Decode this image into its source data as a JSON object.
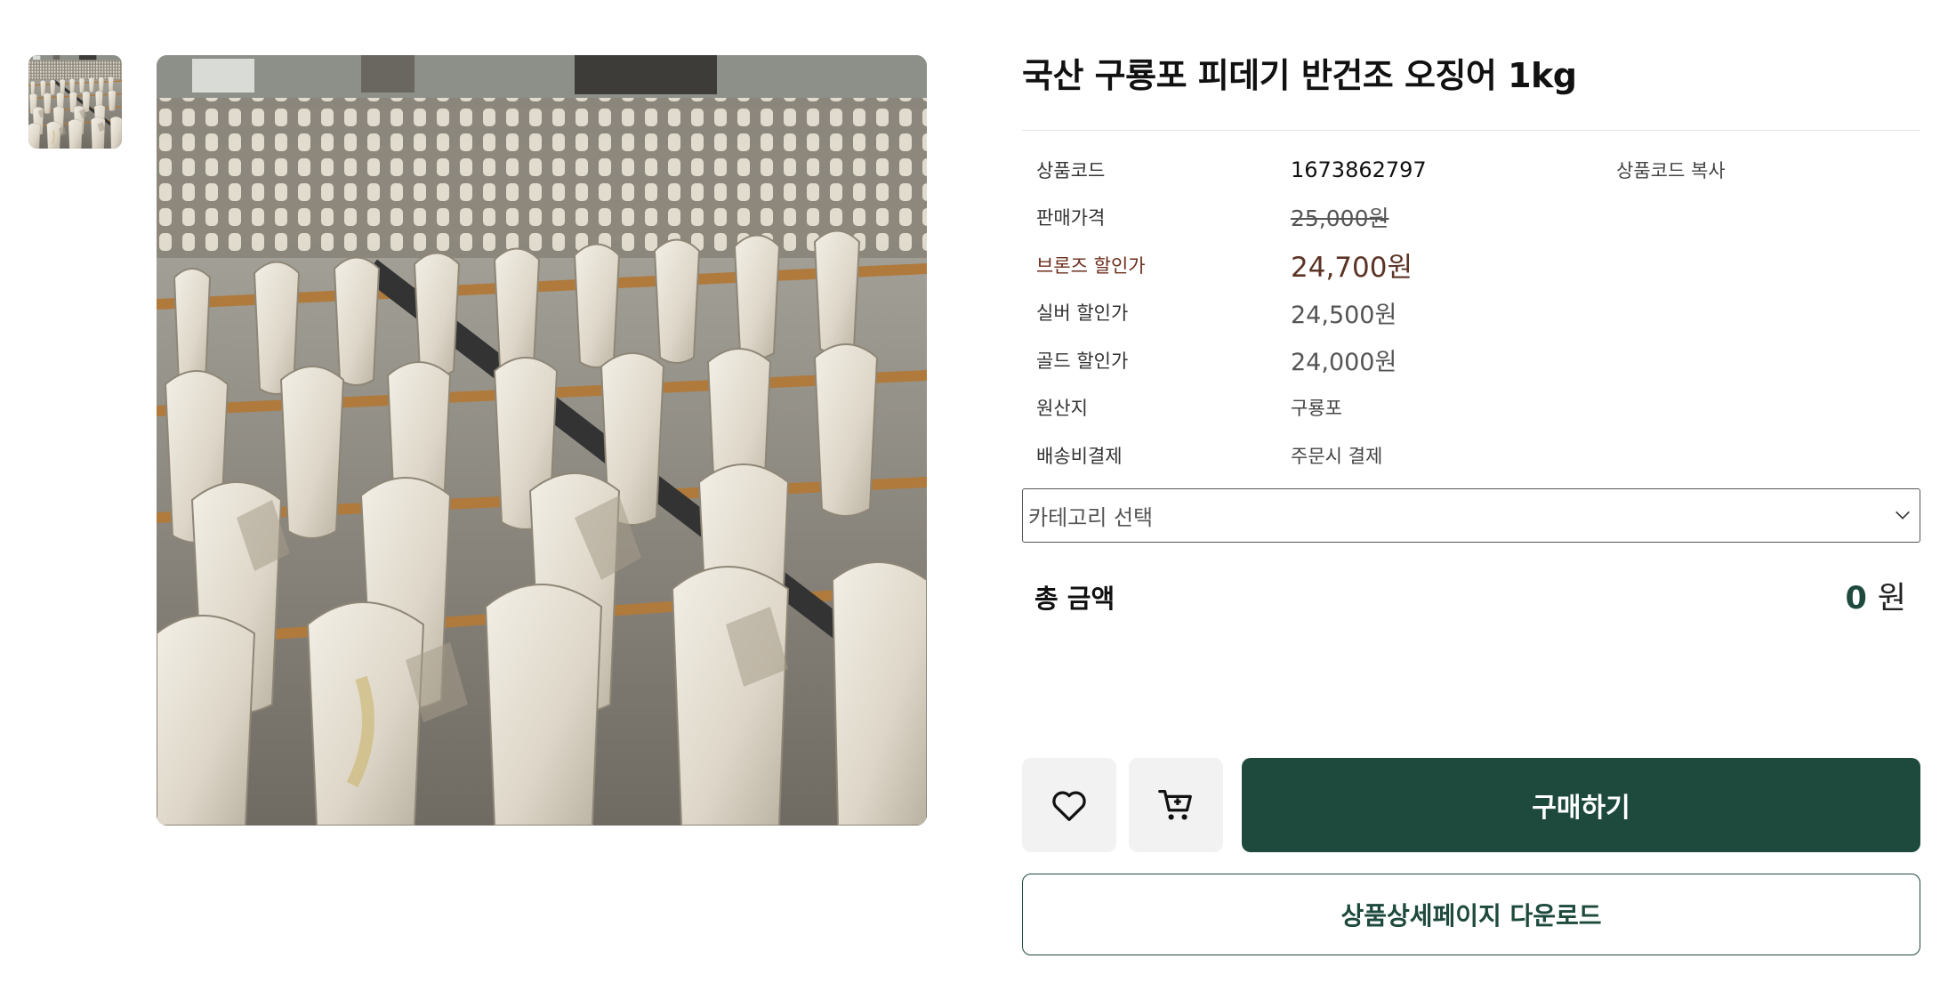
{
  "product": {
    "title": "국산 구룡포 피데기 반건조 오징어 1kg",
    "code_label": "상품코드",
    "code_value": "1673862797",
    "copy_code_label": "상품코드 복사",
    "price_label": "판매가격",
    "price_value": "25,000원",
    "bronze_label": "브론즈 할인가",
    "bronze_value": "24,700원",
    "silver_label": "실버 할인가",
    "silver_value": "24,500원",
    "gold_label": "골드 할인가",
    "gold_value": "24,000원",
    "origin_label": "원산지",
    "origin_value": "구룡포",
    "shipping_label": "배송비결제",
    "shipping_value": "주문시 결제"
  },
  "option_select": {
    "selected": "카테고리 선택",
    "icon": "chevron-down-icon"
  },
  "total": {
    "label": "총 금액",
    "amount": "0",
    "unit": "원"
  },
  "actions": {
    "wishlist_icon": "heart-icon",
    "cart_icon": "cart-icon",
    "buy_label": "구매하기",
    "download_label": "상품상세페이지 다운로드"
  },
  "colors": {
    "brand_green": "#1e4a3d",
    "bronze": "#5b3426"
  }
}
